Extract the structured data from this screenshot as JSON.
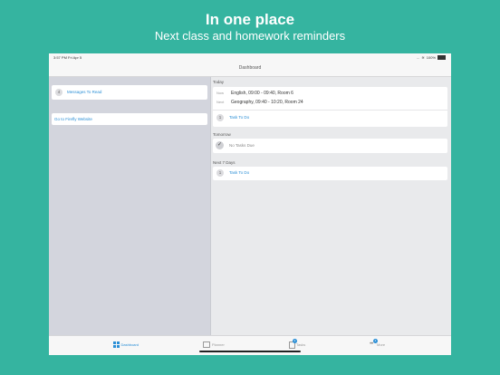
{
  "hero": {
    "title": "In one place",
    "subtitle": "Next class and homework reminders"
  },
  "status_bar": {
    "time": "3:57 PM  Fri Apr 5",
    "dots": "...",
    "battery": "100%"
  },
  "nav": {
    "title": "Dashboard"
  },
  "left": {
    "messages": {
      "count": "4",
      "label": "Messages To Read"
    },
    "firefly_link": "Go to Firefly Website"
  },
  "today": {
    "label": "Today",
    "now_label": "Now",
    "now_value": "English, 09:00 - 09:40, Room 6",
    "next_label": "Next",
    "next_value": "Geography, 09:40 - 10:20, Room 24",
    "task_count": "1",
    "task_label": "Task To Do"
  },
  "tomorrow": {
    "label": "Tomorrow",
    "check": "✓",
    "status": "No Tasks Due"
  },
  "next7": {
    "label": "Next 7 Days",
    "task_count": "1",
    "task_label": "Task To Do"
  },
  "tabs": {
    "dashboard": "Dashboard",
    "planner": "Planner",
    "tasks": "Tasks",
    "tasks_badge": "2",
    "more": "More",
    "more_badge": "4"
  },
  "colors": {
    "background": "#35b4a0",
    "accent": "#2b8fd6"
  }
}
